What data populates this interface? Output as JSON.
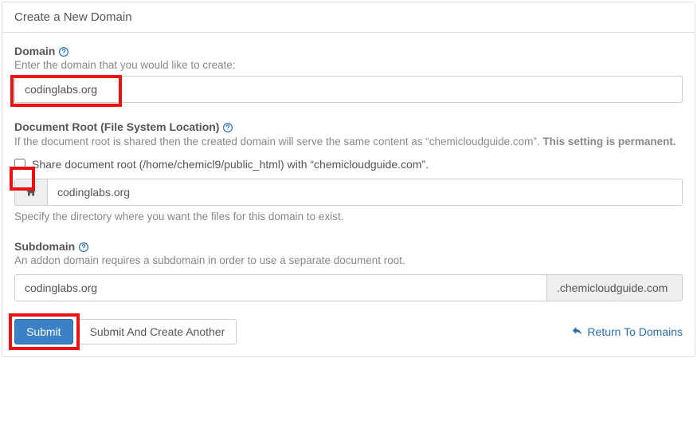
{
  "panel": {
    "title": "Create a New Domain"
  },
  "domain": {
    "label": "Domain",
    "help": "Enter the domain that you would like to create:",
    "value": "codinglabs.org"
  },
  "docroot": {
    "label": "Document Root (File System Location)",
    "note_prefix": "If the document root is shared then the created domain will serve the same content as “chemicloudguide.com”. ",
    "note_bold": "This setting is permanent.",
    "share_label": "Share document root (/home/chemicl9/public_html) with “chemicloudguide.com”.",
    "path_value": "codinglabs.org",
    "hint": "Specify the directory where you want the files for this domain to exist."
  },
  "subdomain": {
    "label": "Subdomain",
    "help": "An addon domain requires a subdomain in order to use a separate document root.",
    "value": "codinglabs.org",
    "suffix": ".chemicloudguide.com"
  },
  "actions": {
    "submit": "Submit",
    "submit_another": "Submit And Create Another",
    "return": "Return To Domains"
  }
}
